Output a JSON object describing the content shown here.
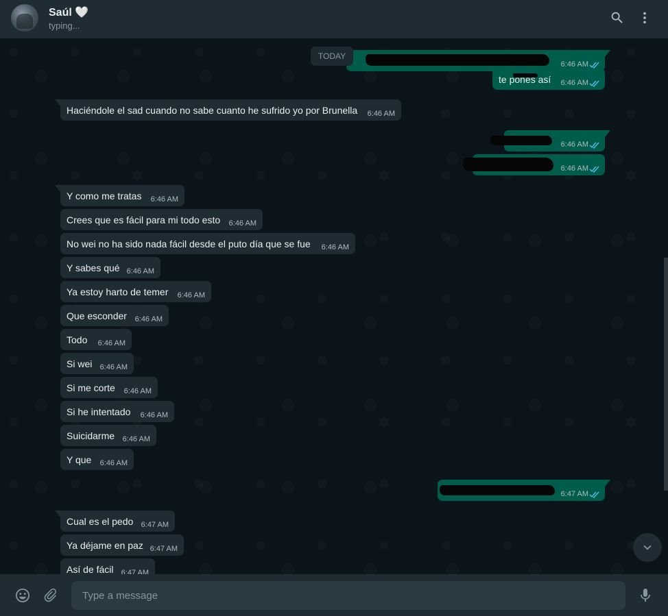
{
  "header": {
    "contact_name": "Saúl 🤍",
    "status": "typing...",
    "search_icon": "search-icon",
    "menu_icon": "kebab-menu-icon"
  },
  "chat": {
    "date_chip": "TODAY",
    "messages": [
      {
        "dir": "out",
        "text": "",
        "time": "6:46 AM",
        "redacted": true
      },
      {
        "dir": "out",
        "text": "te pones así",
        "time": "6:46 AM"
      },
      {
        "dir": "in",
        "text": "Haciéndole el sad cuando no sabe cuanto he sufrido yo por Brunella",
        "time": "6:46 AM"
      },
      {
        "dir": "out",
        "text": "",
        "time": "6:46 AM",
        "redacted": true
      },
      {
        "dir": "out",
        "text": "",
        "time": "6:46 AM",
        "redacted": true
      },
      {
        "dir": "in",
        "text": "Y como me tratas",
        "time": "6:46 AM"
      },
      {
        "dir": "in",
        "text": "Crees que es fácil para mi todo esto",
        "time": "6:46 AM"
      },
      {
        "dir": "in",
        "text": "No wei no ha sido nada fácil desde el puto día que se fue",
        "time": "6:46 AM"
      },
      {
        "dir": "in",
        "text": "Y sabes qué",
        "time": "6:46 AM"
      },
      {
        "dir": "in",
        "text": "Ya estoy harto de temer",
        "time": "6:46 AM"
      },
      {
        "dir": "in",
        "text": "Que esconder",
        "time": "6:46 AM"
      },
      {
        "dir": "in",
        "text": "Todo",
        "time": "6:46 AM"
      },
      {
        "dir": "in",
        "text": "Si wei",
        "time": "6:46 AM"
      },
      {
        "dir": "in",
        "text": "Si me corte",
        "time": "6:46 AM"
      },
      {
        "dir": "in",
        "text": "Si he intentado",
        "time": "6:46 AM"
      },
      {
        "dir": "in",
        "text": "Suicidarme",
        "time": "6:46 AM"
      },
      {
        "dir": "in",
        "text": "Y que",
        "time": "6:46 AM"
      },
      {
        "dir": "out",
        "text": "",
        "time": "6:47 AM",
        "redacted": true
      },
      {
        "dir": "in",
        "text": "Cual es el pedo",
        "time": "6:47 AM"
      },
      {
        "dir": "in",
        "text": "Ya déjame en paz",
        "time": "6:47 AM"
      },
      {
        "dir": "in",
        "text": "Así de fácil",
        "time": "6:47 AM"
      }
    ],
    "scroll_down_icon": "chevron-down-icon"
  },
  "footer": {
    "emoji_icon": "emoji-icon",
    "attach_icon": "paperclip-icon",
    "input_placeholder": "Type a message",
    "input_value": "",
    "mic_icon": "microphone-icon"
  },
  "colors": {
    "background": "#0b141a",
    "panel": "#202c33",
    "incoming_bubble": "#202c33",
    "outgoing_bubble": "#005c4b",
    "read_ticks": "#53bdeb"
  }
}
